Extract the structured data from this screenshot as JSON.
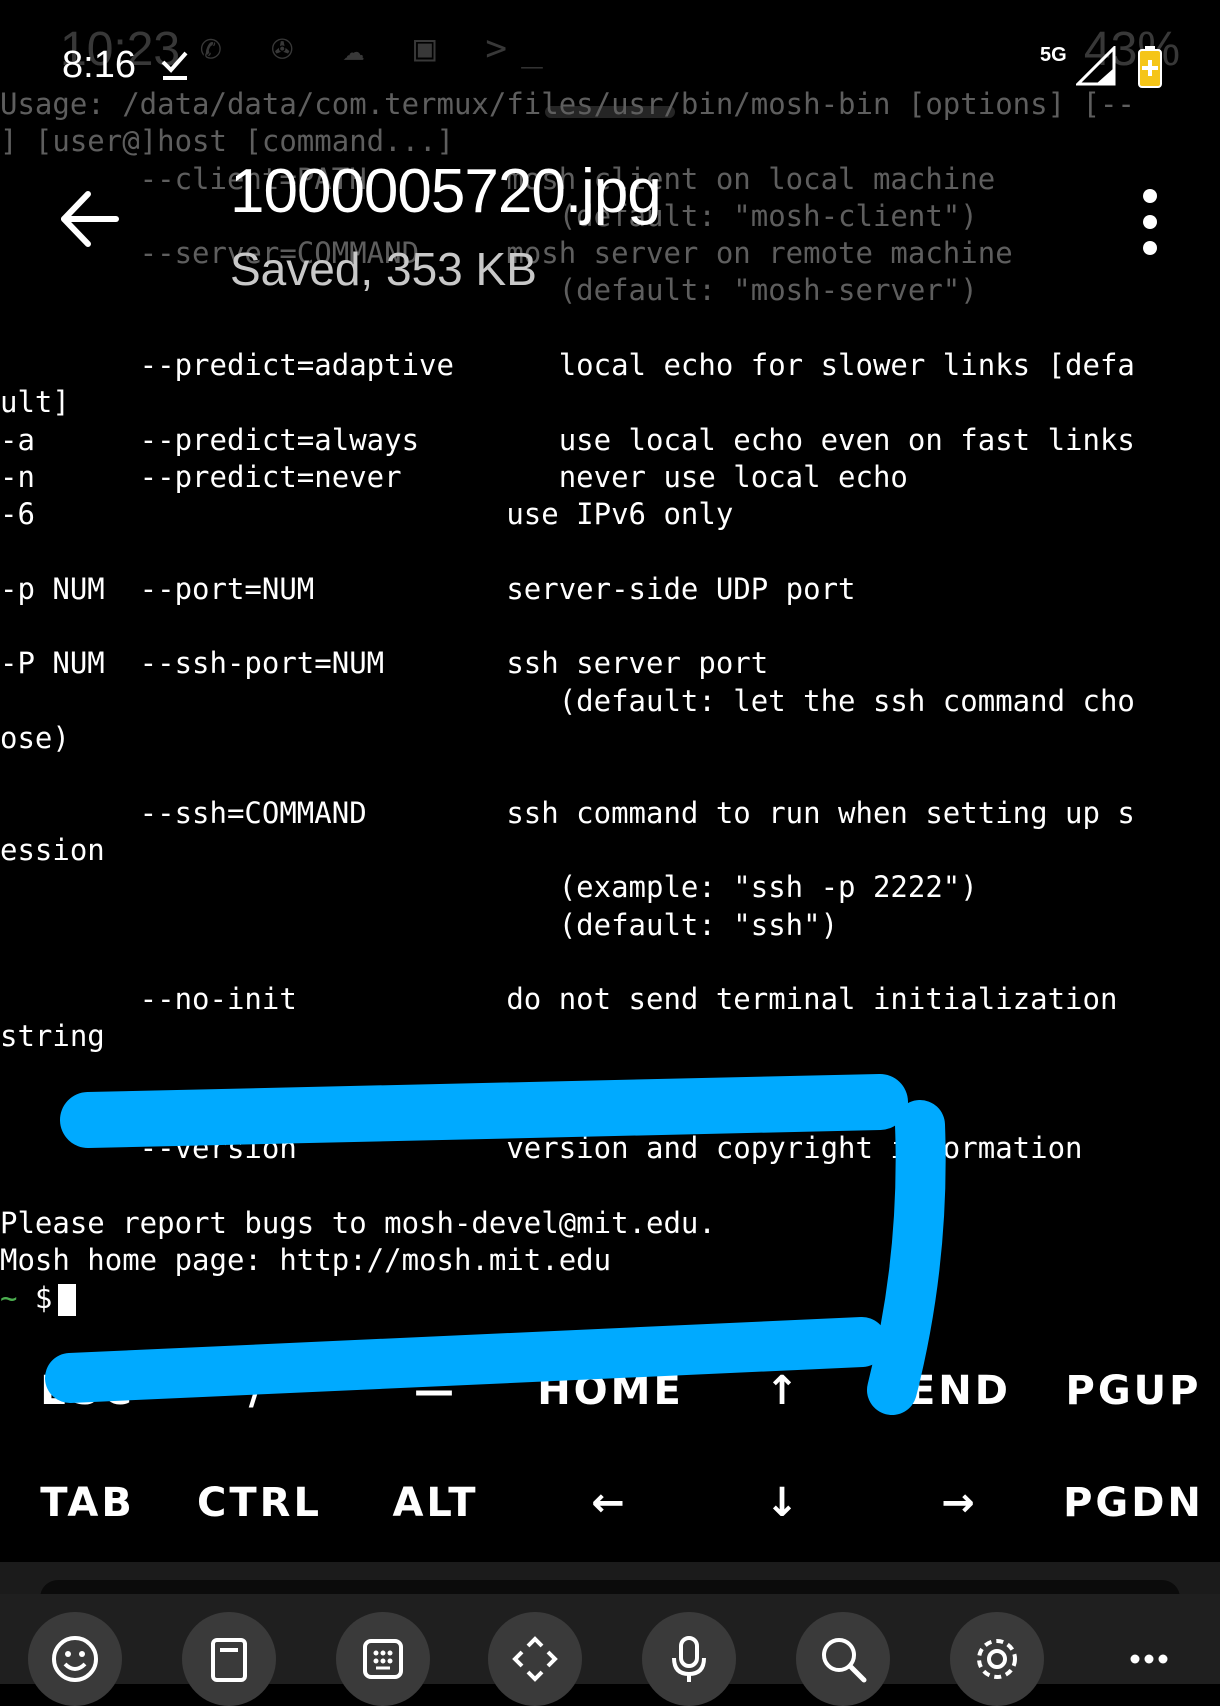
{
  "ghost_status": {
    "time": "10:23",
    "battery": "43%"
  },
  "status_bar": {
    "time": "8:16",
    "network": "5G"
  },
  "viewer": {
    "title": "1000005720.jpg",
    "subtitle": "Saved, 353 KB",
    "back_icon": "arrow-left-icon",
    "menu_icon": "more-vertical-icon"
  },
  "terminal": {
    "faded_lines": [
      "Usage: /data/data/com.termux/files/usr/bin/mosh-bin [options] [--",
      "] [user@]host [command...]",
      "        --client=PATH        mosh client on local machine",
      "                                (default: \"mosh-client\")",
      "        --server=COMMAND     mosh server on remote machine",
      "                                (default: \"mosh-server\")"
    ],
    "lines": [
      "",
      "        --predict=adaptive      local echo for slower links [defa",
      "ult]",
      "-a      --predict=always        use local echo even on fast links",
      "-n      --predict=never         never use local echo",
      "-6                           use IPv6 only",
      "",
      "-p NUM  --port=NUM           server-side UDP port",
      "",
      "-P NUM  --ssh-port=NUM       ssh server port",
      "                                (default: let the ssh command cho",
      "ose)",
      "",
      "        --ssh=COMMAND        ssh command to run when setting up s",
      "ession",
      "                                (example: \"ssh -p 2222\")",
      "                                (default: \"ssh\")",
      "",
      "        --no-init            do not send terminal initialization",
      "string",
      "",
      "",
      "        --version            version and copyright information",
      "",
      "Please report bugs to mosh-devel@mit.edu.",
      "Mosh home page: http://mosh.mit.edu"
    ],
    "prompt_tilde": "~",
    "prompt_symbol": " $"
  },
  "extra_keys": {
    "row1": [
      "ESC",
      "/",
      "—",
      "HOME",
      "↑",
      "END",
      "PGUP"
    ],
    "row2": [
      "TAB",
      "CTRL",
      "ALT",
      "←",
      "↓",
      "→",
      "PGDN"
    ]
  },
  "toolbar": {
    "items": [
      "emoji-icon",
      "clipboard-icon",
      "keyboard-icon",
      "move-icon",
      "microphone-icon",
      "search-icon",
      "settings-icon",
      "more-horizontal-icon"
    ]
  },
  "colors": {
    "annotation_blue": "#00aaff",
    "prompt_green": "#4caf50"
  }
}
